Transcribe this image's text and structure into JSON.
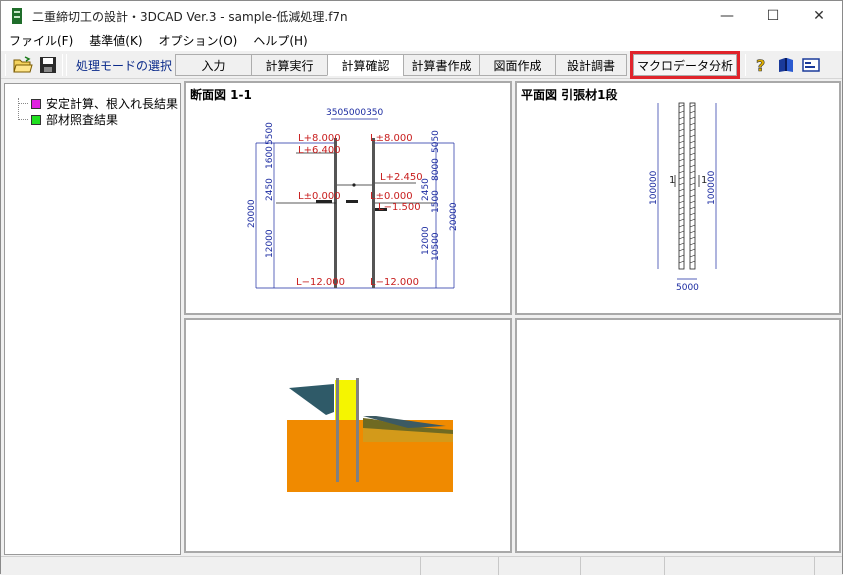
{
  "window": {
    "title": "二重締切工の設計・3DCAD Ver.3 - sample-低減処理.f7n",
    "min": "—",
    "max": "☐",
    "close": "✕"
  },
  "menu": {
    "items": [
      "ファイル(F)",
      "基準値(K)",
      "オプション(O)",
      "ヘルプ(H)"
    ]
  },
  "toolbar": {
    "mode_label": "処理モードの選択",
    "buttons": [
      "入力",
      "計算実行",
      "計算確認",
      "計算書作成",
      "図面作成",
      "設計調書",
      "マクロデータ分析"
    ],
    "active_index": 2,
    "highlight_index": 6
  },
  "tree": {
    "items": [
      {
        "label": "安定計算、根入れ長結果",
        "color": "#e020e0"
      },
      {
        "label": "部材照査結果",
        "color": "#20e020"
      }
    ]
  },
  "section_view": {
    "title": "断面図 1-1",
    "top_dims": "3505000350",
    "levels_left": [
      "L+8.000",
      "L+6.400",
      "L±0.000",
      "L−12.000"
    ],
    "levels_right": [
      "L±8.000",
      "L+2.450",
      "L±0.000",
      "L−1.500",
      "L−12.000"
    ],
    "dims_left": [
      "20000",
      "12000",
      "2450",
      "1600",
      "8000"
    ],
    "dims_right": [
      "8000",
      "5050",
      "2450",
      "1500",
      "12000",
      "10500",
      "20000"
    ],
    "left_col_top": "5500"
  },
  "plan_view": {
    "title": "平面図 引張材1段",
    "dim_left": "100000",
    "dim_right": "100000",
    "dim_bottom": "5000",
    "label_left": "1",
    "label_right": "1"
  },
  "colors": {
    "accent_red": "#e0242b",
    "soil_orange": "#f08a00",
    "wall_yellow": "#f5f500",
    "slope_teal": "#2f5a68",
    "dim_blue": "#1a2aa0",
    "level_red": "#c81e1e"
  }
}
